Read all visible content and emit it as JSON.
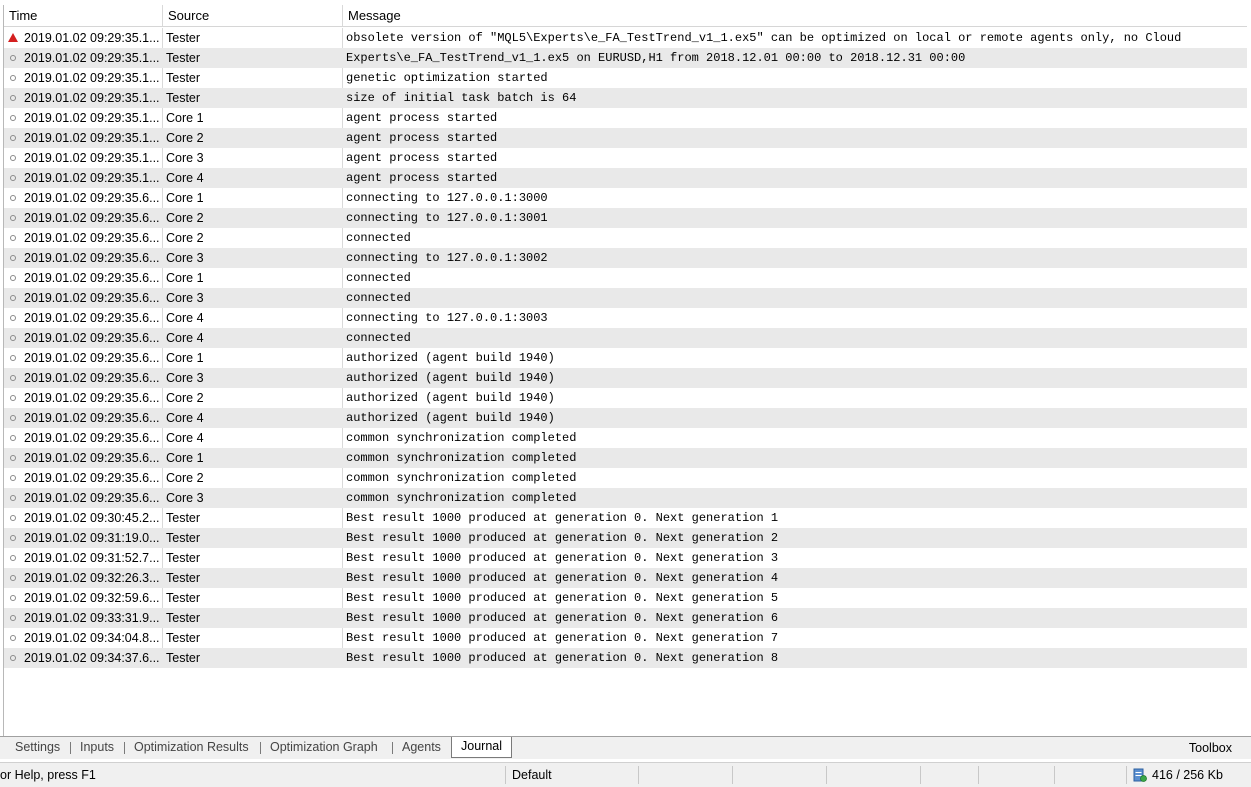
{
  "columns": {
    "time": "Time",
    "source": "Source",
    "message": "Message"
  },
  "rows": [
    {
      "icon": "warning-icon",
      "time": "2019.01.02 09:29:35.1...",
      "source": "Tester",
      "message": "obsolete version of \"MQL5\\Experts\\e_FA_TestTrend_v1_1.ex5\" can be optimized on local or remote agents only, no Cloud"
    },
    {
      "icon": "info-icon",
      "time": "2019.01.02 09:29:35.1...",
      "source": "Tester",
      "message": "Experts\\e_FA_TestTrend_v1_1.ex5 on EURUSD,H1 from 2018.12.01 00:00 to 2018.12.31 00:00"
    },
    {
      "icon": "info-icon",
      "time": "2019.01.02 09:29:35.1...",
      "source": "Tester",
      "message": "genetic optimization started"
    },
    {
      "icon": "info-icon",
      "time": "2019.01.02 09:29:35.1...",
      "source": "Tester",
      "message": "size of initial task batch is 64"
    },
    {
      "icon": "info-icon",
      "time": "2019.01.02 09:29:35.1...",
      "source": "Core 1",
      "message": "agent process started"
    },
    {
      "icon": "info-icon",
      "time": "2019.01.02 09:29:35.1...",
      "source": "Core 2",
      "message": "agent process started"
    },
    {
      "icon": "info-icon",
      "time": "2019.01.02 09:29:35.1...",
      "source": "Core 3",
      "message": "agent process started"
    },
    {
      "icon": "info-icon",
      "time": "2019.01.02 09:29:35.1...",
      "source": "Core 4",
      "message": "agent process started"
    },
    {
      "icon": "info-icon",
      "time": "2019.01.02 09:29:35.6...",
      "source": "Core 1",
      "message": "connecting to 127.0.0.1:3000"
    },
    {
      "icon": "info-icon",
      "time": "2019.01.02 09:29:35.6...",
      "source": "Core 2",
      "message": "connecting to 127.0.0.1:3001"
    },
    {
      "icon": "info-icon",
      "time": "2019.01.02 09:29:35.6...",
      "source": "Core 2",
      "message": "connected"
    },
    {
      "icon": "info-icon",
      "time": "2019.01.02 09:29:35.6...",
      "source": "Core 3",
      "message": "connecting to 127.0.0.1:3002"
    },
    {
      "icon": "info-icon",
      "time": "2019.01.02 09:29:35.6...",
      "source": "Core 1",
      "message": "connected"
    },
    {
      "icon": "info-icon",
      "time": "2019.01.02 09:29:35.6...",
      "source": "Core 3",
      "message": "connected"
    },
    {
      "icon": "info-icon",
      "time": "2019.01.02 09:29:35.6...",
      "source": "Core 4",
      "message": "connecting to 127.0.0.1:3003"
    },
    {
      "icon": "info-icon",
      "time": "2019.01.02 09:29:35.6...",
      "source": "Core 4",
      "message": "connected"
    },
    {
      "icon": "info-icon",
      "time": "2019.01.02 09:29:35.6...",
      "source": "Core 1",
      "message": "authorized (agent build 1940)"
    },
    {
      "icon": "info-icon",
      "time": "2019.01.02 09:29:35.6...",
      "source": "Core 3",
      "message": "authorized (agent build 1940)"
    },
    {
      "icon": "info-icon",
      "time": "2019.01.02 09:29:35.6...",
      "source": "Core 2",
      "message": "authorized (agent build 1940)"
    },
    {
      "icon": "info-icon",
      "time": "2019.01.02 09:29:35.6...",
      "source": "Core 4",
      "message": "authorized (agent build 1940)"
    },
    {
      "icon": "info-icon",
      "time": "2019.01.02 09:29:35.6...",
      "source": "Core 4",
      "message": "common synchronization completed"
    },
    {
      "icon": "info-icon",
      "time": "2019.01.02 09:29:35.6...",
      "source": "Core 1",
      "message": "common synchronization completed"
    },
    {
      "icon": "info-icon",
      "time": "2019.01.02 09:29:35.6...",
      "source": "Core 2",
      "message": "common synchronization completed"
    },
    {
      "icon": "info-icon",
      "time": "2019.01.02 09:29:35.6...",
      "source": "Core 3",
      "message": "common synchronization completed"
    },
    {
      "icon": "info-icon",
      "time": "2019.01.02 09:30:45.2...",
      "source": "Tester",
      "message": "Best result 1000 produced at generation 0. Next generation 1"
    },
    {
      "icon": "info-icon",
      "time": "2019.01.02 09:31:19.0...",
      "source": "Tester",
      "message": "Best result 1000 produced at generation 0. Next generation 2"
    },
    {
      "icon": "info-icon",
      "time": "2019.01.02 09:31:52.7...",
      "source": "Tester",
      "message": "Best result 1000 produced at generation 0. Next generation 3"
    },
    {
      "icon": "info-icon",
      "time": "2019.01.02 09:32:26.3...",
      "source": "Tester",
      "message": "Best result 1000 produced at generation 0. Next generation 4"
    },
    {
      "icon": "info-icon",
      "time": "2019.01.02 09:32:59.6...",
      "source": "Tester",
      "message": "Best result 1000 produced at generation 0. Next generation 5"
    },
    {
      "icon": "info-icon",
      "time": "2019.01.02 09:33:31.9...",
      "source": "Tester",
      "message": "Best result 1000 produced at generation 0. Next generation 6"
    },
    {
      "icon": "info-icon",
      "time": "2019.01.02 09:34:04.8...",
      "source": "Tester",
      "message": "Best result 1000 produced at generation 0. Next generation 7"
    },
    {
      "icon": "info-icon",
      "time": "2019.01.02 09:34:37.6...",
      "source": "Tester",
      "message": "Best result 1000 produced at generation 0. Next generation 8"
    }
  ],
  "tabs": {
    "settings": "Settings",
    "inputs": "Inputs",
    "optimization_results": "Optimization Results",
    "optimization_graph": "Optimization Graph",
    "agents": "Agents",
    "journal": "Journal",
    "active": "Journal"
  },
  "toolbox": "Toolbox",
  "status": {
    "help": "or Help, press F1",
    "profile": "Default",
    "memory_icon": "database-icon",
    "memory": "416 / 256 Kb"
  },
  "colors": {
    "warning": "#d42020",
    "row_alt": "#e9e9e9"
  }
}
